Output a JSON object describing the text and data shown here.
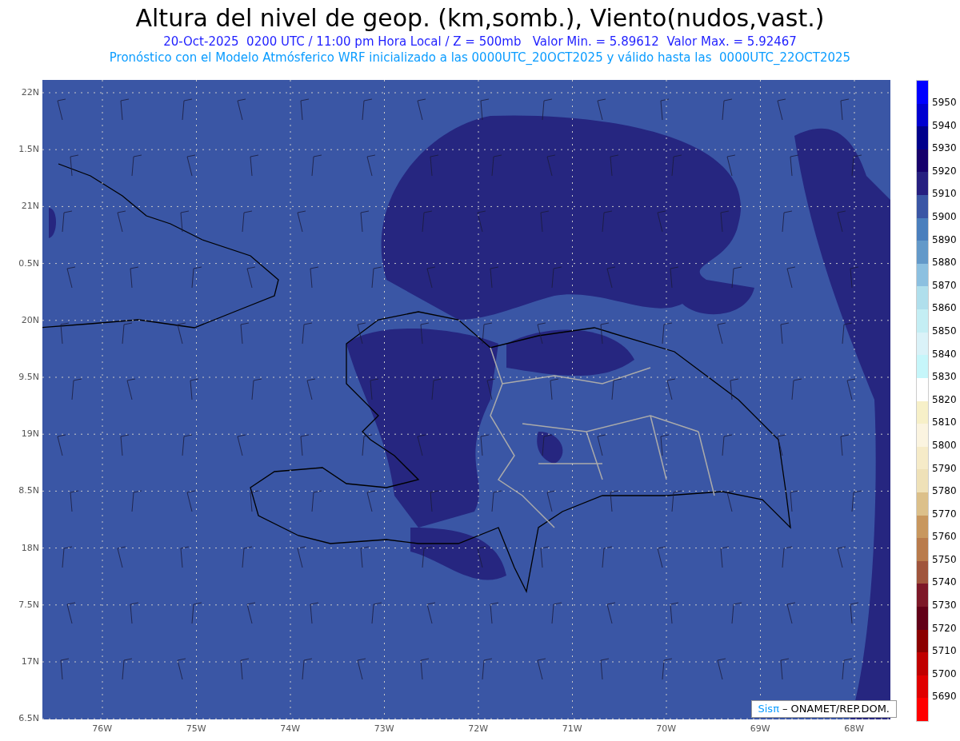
{
  "title": "Altura del nivel de geop. (km,somb.), Viento(nudos,vast.)",
  "subtitle": "20-Oct-2025  0200 UTC / 11:00 pm Hora Local / Z = 500mb   Valor Min. = 5.89612  Valor Max. = 5.92467",
  "forecast_note": "Pronóstico con el Modelo Atmósferico WRF inicializado a las 0000UTC_20OCT2025 y válido hasta las  0000UTC_22OCT2025",
  "lat_labels": [
    "22N",
    "1.5N",
    "21N",
    "0.5N",
    "20N",
    "9.5N",
    "19N",
    "8.5N",
    "18N",
    "7.5N",
    "17N",
    "6.5N"
  ],
  "lon_labels": [
    "76W",
    "75W",
    "74W",
    "73W",
    "72W",
    "71W",
    "70W",
    "69W",
    "68W"
  ],
  "credit": {
    "brand": "Sisπ",
    "text": "– ONAMET/REP.DOM."
  },
  "colorbar": [
    {
      "color": "#0000ff",
      "label": "5950"
    },
    {
      "color": "#0000d0",
      "label": "5940"
    },
    {
      "color": "#00008b",
      "label": "5930"
    },
    {
      "color": "#16006b",
      "label": "5920"
    },
    {
      "color": "#261f80",
      "label": "5910"
    },
    {
      "color": "#3a56a5",
      "label": "5900"
    },
    {
      "color": "#4a7fbd",
      "label": "5890"
    },
    {
      "color": "#6399c9",
      "label": "5880"
    },
    {
      "color": "#8cc0e0",
      "label": "5870"
    },
    {
      "color": "#b0dfec",
      "label": "5860"
    },
    {
      "color": "#c4eef4",
      "label": "5850"
    },
    {
      "color": "#daf2f8",
      "label": "5840"
    },
    {
      "color": "#c6f6fa",
      "label": "5830"
    },
    {
      "color": "#ffffff",
      "label": "5820"
    },
    {
      "color": "#f7f0c8",
      "label": "5810"
    },
    {
      "color": "#fbf4e0",
      "label": "5800"
    },
    {
      "color": "#f6ebc8",
      "label": "5790"
    },
    {
      "color": "#efe1b8",
      "label": "5780"
    },
    {
      "color": "#dcc08a",
      "label": "5770"
    },
    {
      "color": "#c8975e",
      "label": "5760"
    },
    {
      "color": "#b97b4c",
      "label": "5750"
    },
    {
      "color": "#a0553c",
      "label": "5740"
    },
    {
      "color": "#7d1828",
      "label": "5730"
    },
    {
      "color": "#620018",
      "label": "5720"
    },
    {
      "color": "#8b0000",
      "label": "5710"
    },
    {
      "color": "#c00000",
      "label": "5700"
    },
    {
      "color": "#e00000",
      "label": "5690"
    },
    {
      "color": "#ff0000"
    }
  ]
}
